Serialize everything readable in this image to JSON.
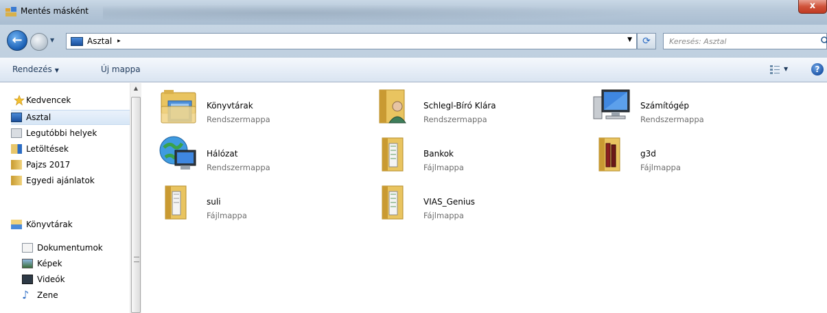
{
  "window": {
    "title": "Mentés másként",
    "close_label": "x"
  },
  "address_bar": {
    "path": "Asztal",
    "separator": "▸",
    "search_placeholder": "Keresés: Asztal"
  },
  "toolbar": {
    "organize_label": "Rendezés",
    "new_folder_label": "Új mappa",
    "dropdown_glyph": "▼",
    "help_glyph": "?"
  },
  "sidebar": {
    "favorites": {
      "header": "Kedvencek",
      "items": [
        {
          "label": "Asztal",
          "icon": "desktop-icon",
          "selected": true
        },
        {
          "label": "Legutóbbi helyek",
          "icon": "recent-places-icon"
        },
        {
          "label": "Letöltések",
          "icon": "downloads-icon"
        },
        {
          "label": "Pajzs 2017",
          "icon": "folder-icon"
        },
        {
          "label": "Egyedi ajánlatok",
          "icon": "folder-icon"
        }
      ]
    },
    "libraries": {
      "header": "Könyvtárak",
      "items": [
        {
          "label": "Dokumentumok",
          "icon": "documents-icon"
        },
        {
          "label": "Képek",
          "icon": "pictures-icon"
        },
        {
          "label": "Videók",
          "icon": "videos-icon"
        },
        {
          "label": "Zene",
          "icon": "music-icon"
        }
      ]
    }
  },
  "content": {
    "items": [
      {
        "name": "Könyvtárak",
        "type": "Rendszermappa",
        "icon": "libraries-icon"
      },
      {
        "name": "Schlegl-Bíró Klára",
        "type": "Rendszermappa",
        "icon": "user-folder-icon"
      },
      {
        "name": "Számítógép",
        "type": "Rendszermappa",
        "icon": "computer-icon"
      },
      {
        "name": "Hálózat",
        "type": "Rendszermappa",
        "icon": "network-icon"
      },
      {
        "name": "Bankok",
        "type": "Fájlmappa",
        "icon": "folder-icon"
      },
      {
        "name": "g3d",
        "type": "Fájlmappa",
        "icon": "folder-icon"
      },
      {
        "name": "suli",
        "type": "Fájlmappa",
        "icon": "folder-icon"
      },
      {
        "name": "VIAS_Genius",
        "type": "Fájlmappa",
        "icon": "folder-icon"
      }
    ]
  },
  "colors": {
    "title_bar": "#b7c8d9",
    "selection": "#d7e6f6",
    "folder": "#e8c66a",
    "type_text": "#6d6d6d"
  }
}
